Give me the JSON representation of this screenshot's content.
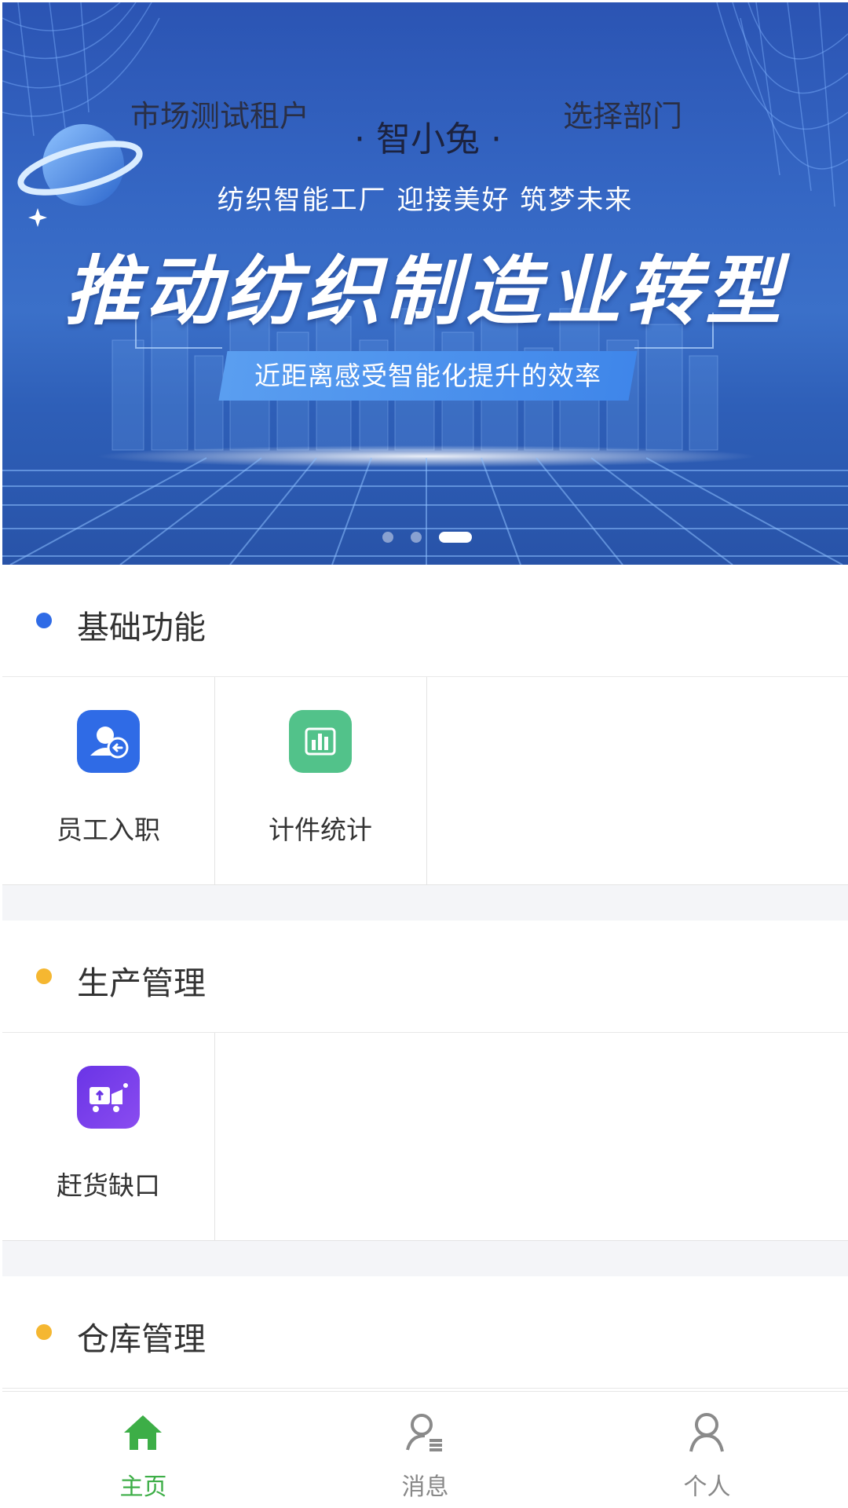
{
  "banner": {
    "tenant": "市场测试租户",
    "app_name": "· 智小兔 ·",
    "department": "选择部门",
    "slogan": "纺织智能工厂 迎接美好 筑梦未来",
    "headline": "推动纺织制造业转型",
    "ribbon": "近距离感受智能化提升的效率",
    "carousel": {
      "count": 3,
      "active_index": 2
    }
  },
  "sections": [
    {
      "title": "基础功能",
      "dot_color": "#2f6be6",
      "items": [
        {
          "label": "员工入职",
          "icon": "employee-onboard-icon",
          "color": "#2f6be6"
        },
        {
          "label": "计件统计",
          "icon": "bar-chart-icon",
          "color": "#52c28a"
        }
      ]
    },
    {
      "title": "生产管理",
      "dot_color": "#f5b731",
      "items": [
        {
          "label": "赶货缺口",
          "icon": "delivery-truck-icon",
          "color": "#7a3ee8"
        }
      ]
    },
    {
      "title": "仓库管理",
      "dot_color": "#f5b731",
      "items": []
    }
  ],
  "tabbar": {
    "tabs": [
      {
        "label": "主页",
        "icon": "home-icon",
        "active": true
      },
      {
        "label": "消息",
        "icon": "message-user-icon",
        "active": false
      },
      {
        "label": "个人",
        "icon": "person-icon",
        "active": false
      }
    ],
    "active_color": "#3dae47",
    "inactive_color": "#888888"
  }
}
